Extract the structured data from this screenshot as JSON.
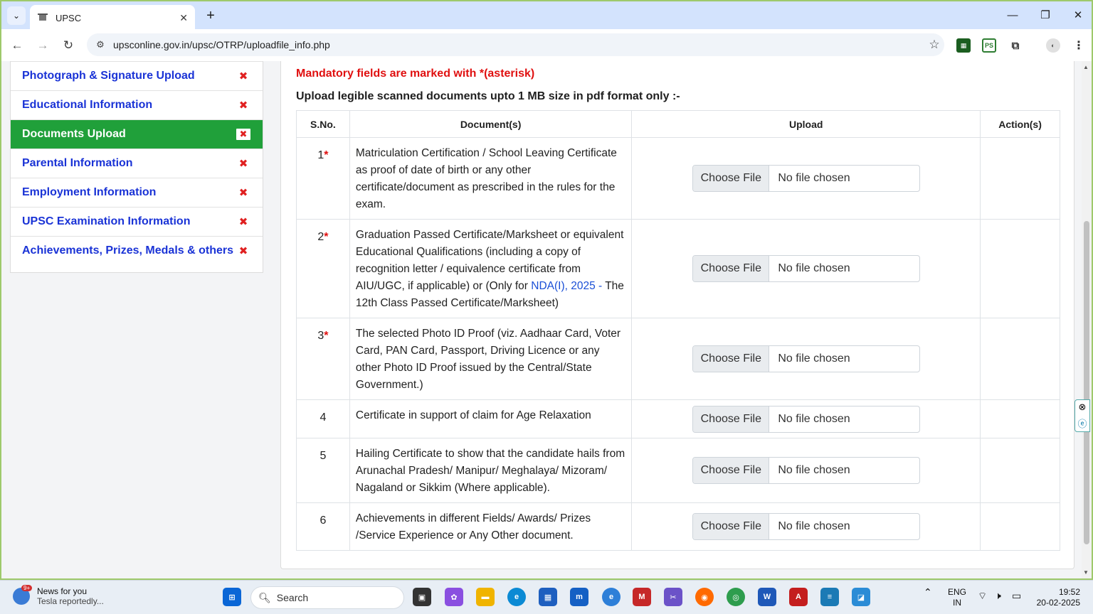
{
  "browser": {
    "tab_title": "UPSC",
    "url": "upsconline.gov.in/upsc/OTRP/uploadfile_info.php",
    "new_tab": "+",
    "minimize": "—",
    "restore": "❐",
    "close": "✕"
  },
  "sidebar": {
    "items": [
      {
        "label": "Photograph & Signature Upload",
        "status": "✖"
      },
      {
        "label": "Educational Information",
        "status": "✖"
      },
      {
        "label": "Documents Upload",
        "status": "✖"
      },
      {
        "label": "Parental Information",
        "status": "✖"
      },
      {
        "label": "Employment Information",
        "status": "✖"
      },
      {
        "label": "UPSC Examination Information",
        "status": "✖"
      },
      {
        "label": "Achievements, Prizes, Medals & others",
        "status": "✖"
      }
    ],
    "active_index": 2
  },
  "main": {
    "mandatory_note": "Mandatory fields are marked with *(asterisk)",
    "upload_note": "Upload legible scanned documents upto 1 MB size in pdf format only :-",
    "table": {
      "headers": [
        "S.No.",
        "Document(s)",
        "Upload",
        "Action(s)"
      ],
      "rows": [
        {
          "sno": "1",
          "required": "*",
          "doc": "Matriculation Certification / School Leaving Certificate as proof of date of birth or any other certificate/document as prescribed in the rules for the exam."
        },
        {
          "sno": "2",
          "required": "*",
          "doc_pre": "Graduation Passed Certificate/Marksheet or equivalent Educational Qualifications (including a copy of recognition letter / equivalence certificate from AIU/UGC, if applicable) or (Only for ",
          "doc_link": "NDA(I), 2025 -",
          "doc_post": " The 12th Class Passed Certificate/Marksheet)"
        },
        {
          "sno": "3",
          "required": "*",
          "doc": "The selected Photo ID Proof (viz. Aadhaar Card, Voter Card, PAN Card, Passport, Driving Licence or any other Photo ID Proof issued by the Central/State Government.)"
        },
        {
          "sno": "4",
          "required": "",
          "doc": "Certificate in support of claim for Age Relaxation"
        },
        {
          "sno": "5",
          "required": "",
          "doc": "Hailing Certificate to show that the candidate hails from Arunachal Pradesh/ Manipur/ Meghalaya/ Mizoram/ Nagaland or Sikkim (Where applicable)."
        },
        {
          "sno": "6",
          "required": "",
          "doc": "Achievements in different Fields/ Awards/ Prizes /Service Experience or Any Other document."
        }
      ],
      "choose_file_label": "Choose File",
      "no_file_label": "No file chosen"
    }
  },
  "taskbar": {
    "news_title": "News for you",
    "news_sub": "Tesla reportedly...",
    "news_badge": "9+",
    "search_label": "Search",
    "lang": "ENG",
    "region": "IN",
    "time": "19:52",
    "date": "20-02-2025"
  },
  "colors": {
    "active_green": "#20a03a",
    "link_blue": "#1a33d6",
    "required_red": "#e01010"
  }
}
